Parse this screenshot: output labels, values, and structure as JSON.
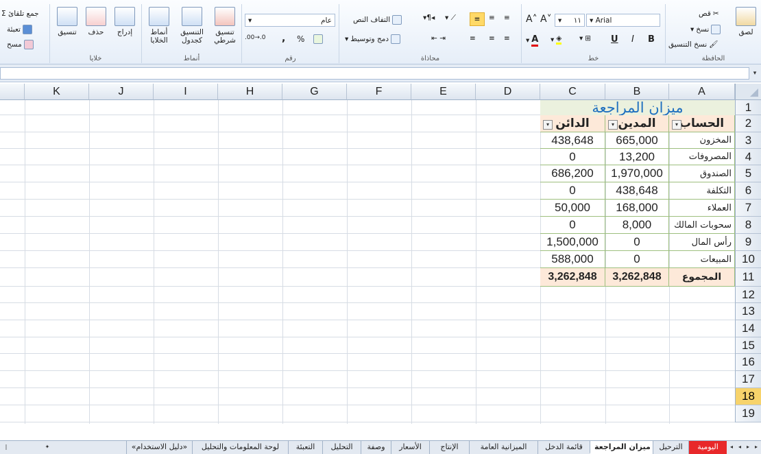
{
  "ribbon": {
    "editing": {
      "autosum": "Σ جمع تلقائ",
      "fill": "تعبئة",
      "clear": "مسح"
    },
    "cells": {
      "format": "تنسيق",
      "delete": "حذف",
      "insert": "إدراج",
      "label": "خلايا"
    },
    "styles": {
      "cell_styles_1": "أنماط",
      "cell_styles_2": "الخلايا",
      "format_table_1": "التنسيق",
      "format_table_2": "كجدول",
      "conditional_1": "تنسيق",
      "conditional_2": "شرطي",
      "label": "أنماط"
    },
    "number": {
      "format_value": "عام",
      "label": "رقم"
    },
    "alignment": {
      "wrap_text": "التفاف النص",
      "merge_center": "دمج وتوسيط",
      "label": "محاذاة"
    },
    "font": {
      "font_name": "Arial",
      "font_size": "١١",
      "bold": "B",
      "italic": "I",
      "underline": "U",
      "label": "خط"
    },
    "clipboard": {
      "paste": "لصق",
      "cut": "قص",
      "copy": "نسخ",
      "format_painter": "نسخ التنسيق",
      "label": "الحافظة"
    }
  },
  "grid": {
    "columns": [
      "A",
      "B",
      "C",
      "D",
      "E",
      "F",
      "G",
      "H",
      "I",
      "J",
      "K"
    ],
    "rows": [
      "1",
      "2",
      "3",
      "4",
      "5",
      "6",
      "7",
      "8",
      "9",
      "10",
      "11",
      "12",
      "13",
      "14",
      "15",
      "16",
      "17",
      "18",
      "19"
    ],
    "selected_row": "18"
  },
  "sheet": {
    "title": "ميزان المراجعة",
    "headers": {
      "account": "الحساب",
      "debit": "المدين",
      "credit": "الدائن"
    },
    "rows": [
      {
        "account": "المخزون",
        "debit": "665,000",
        "credit": "438,648"
      },
      {
        "account": "المصروفات",
        "debit": "13,200",
        "credit": "0"
      },
      {
        "account": "الصندوق",
        "debit": "1,970,000",
        "credit": "686,200"
      },
      {
        "account": "التكلفة",
        "debit": "438,648",
        "credit": "0"
      },
      {
        "account": "العملاء",
        "debit": "168,000",
        "credit": "50,000"
      },
      {
        "account": "سحوبات المالك",
        "debit": "8,000",
        "credit": "0"
      },
      {
        "account": "رأس المال",
        "debit": "0",
        "credit": "1,500,000"
      },
      {
        "account": "المبيعات",
        "debit": "0",
        "credit": "588,000"
      }
    ],
    "total": {
      "label": "المجموع",
      "debit": "3,262,848",
      "credit": "3,262,848"
    }
  },
  "tabs": [
    "اليومية",
    "الترحيل",
    "ميزان المراجعة",
    "قائمة الدخل",
    "الميزانية العامة",
    "الإنتاج",
    "الأسعار",
    "وصفة",
    "التحليل",
    "التعبئة",
    "لوحة المعلومات والتحليل",
    "«دليل الاستخدام»"
  ],
  "active_tab": "ميزان المراجعة"
}
